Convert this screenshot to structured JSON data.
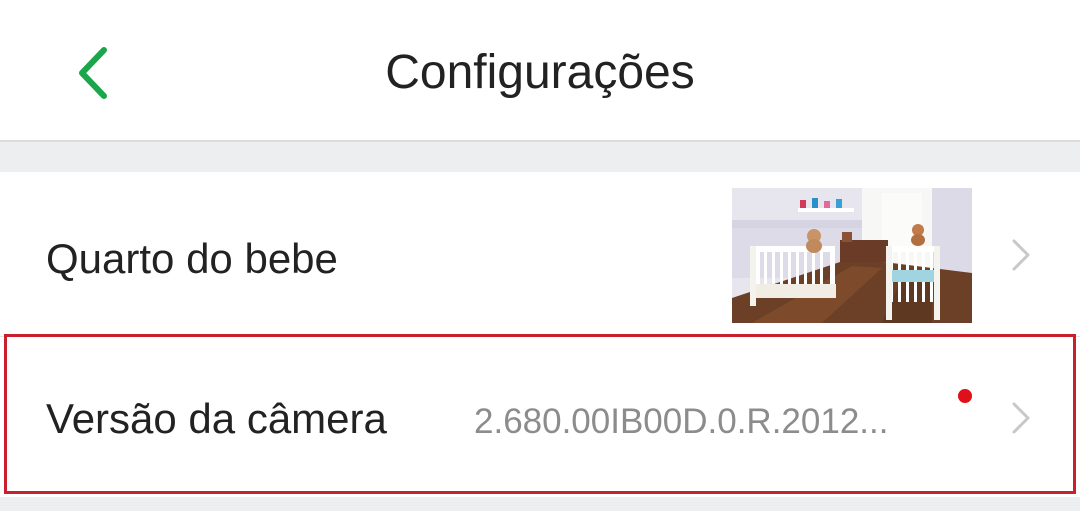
{
  "header": {
    "title": "Configurações",
    "back_icon": "chevron-left-icon",
    "accent_color": "#1aa64a"
  },
  "rows": [
    {
      "label": "Quarto do bebe",
      "thumbnail": "nursery-camera-snapshot",
      "chevron_icon": "chevron-right-icon"
    },
    {
      "label": "Versão da câmera",
      "value": "2.680.00IB00D.0.R.2012...",
      "update_badge_color": "#e0101a",
      "chevron_icon": "chevron-right-icon"
    }
  ],
  "highlight_color": "#c8202c"
}
